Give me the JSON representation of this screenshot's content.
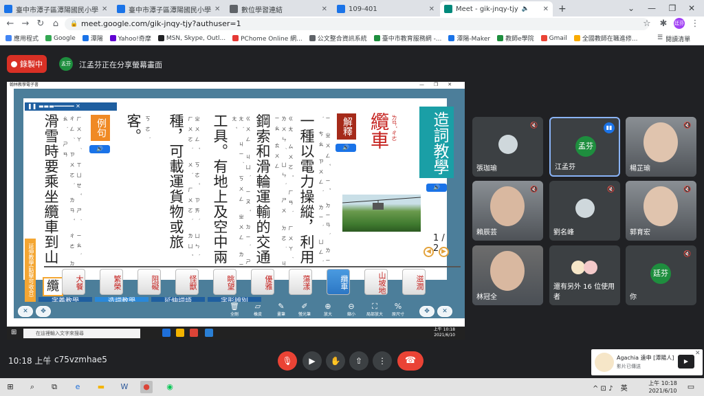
{
  "browser": {
    "tabs": [
      {
        "title": "臺中市潭子區潭陽國民小學",
        "favicon_color": "#1a73e8",
        "active": false
      },
      {
        "title": "臺中市潭子區潭陽國民小學",
        "favicon_color": "#1a73e8",
        "active": false
      },
      {
        "title": "數位學習連結",
        "favicon_color": "#5f6368",
        "active": false
      },
      {
        "title": "109-401",
        "favicon_color": "#1a73e8",
        "active": false
      },
      {
        "title": "Meet - gik-jnqy-tjy",
        "favicon_color": "#00897b",
        "active": true
      }
    ],
    "new_tab": "+",
    "url": "meet.google.com/gik-jnqy-tjy?authuser=1",
    "profile_initials": "廷芬",
    "bookmarks": [
      {
        "label": "應用程式",
        "color": "#4285f4"
      },
      {
        "label": "Google",
        "color": "#34a853"
      },
      {
        "label": "潭陽",
        "color": "#1a73e8"
      },
      {
        "label": "Yahoo!奇摩",
        "color": "#6001d2"
      },
      {
        "label": "MSN, Skype, Outl...",
        "color": "#202124"
      },
      {
        "label": "PChome Online 網...",
        "color": "#e53935"
      },
      {
        "label": "公文整合資訊系統",
        "color": "#5f6368"
      },
      {
        "label": "臺中市教育服務網 -...",
        "color": "#1e8e3e"
      },
      {
        "label": "潭陽-Maker",
        "color": "#1a73e8"
      },
      {
        "label": "教師e學院",
        "color": "#1e8e3e"
      },
      {
        "label": "Gmail",
        "color": "#ea4335"
      },
      {
        "label": "全國教師在職進修...",
        "color": "#f9ab00"
      }
    ],
    "reading_list": "閱讀清單"
  },
  "meet": {
    "record_label": "錄製中",
    "presenter_avatar": "孟芬",
    "presenter_text": "江孟芬正在分享螢幕畫面",
    "clock": "10:18 上午",
    "separator": "|",
    "meeting_code": "c75vzmhae5",
    "participants": [
      {
        "name": "張珈瑜",
        "muted": true,
        "speaking": false,
        "kind": "photo-small"
      },
      {
        "name": "江孟芬",
        "muted": false,
        "speaking": true,
        "avatar": "孟芬",
        "avatar_color": "#1e8e3e",
        "kind": "avatar"
      },
      {
        "name": "楊芷瑜",
        "muted": true,
        "speaking": false,
        "kind": "video"
      },
      {
        "name": "賴辰芸",
        "muted": true,
        "speaking": false,
        "kind": "video"
      },
      {
        "name": "劉名峰",
        "muted": true,
        "speaking": false,
        "kind": "photo-small"
      },
      {
        "name": "郭育宏",
        "muted": true,
        "speaking": false,
        "kind": "video"
      },
      {
        "name": "林冠全",
        "muted": false,
        "speaking": false,
        "kind": "video"
      },
      {
        "name": "還有另外 16 位使用者",
        "muted": false,
        "speaking": false,
        "kind": "group"
      },
      {
        "name": "你",
        "muted": true,
        "speaking": false,
        "avatar": "廷芬",
        "avatar_color": "#1e8e3e",
        "kind": "avatar"
      }
    ]
  },
  "ebook": {
    "window_title": "翰林教學電子書",
    "headword": "纜車",
    "headword_zhuyin": "ㄌㄢˇ ㄔㄜ",
    "category": "造詞教學",
    "explain_badge": "解釋",
    "example_badge": "例句",
    "speaker_icon": "🔊",
    "definition_columns": [
      "一種以電力操縱，利用",
      "鋼索和滑輪運輸的交通",
      "工具。有地上及空中兩",
      "種，可載運貨物或旅",
      "客。"
    ],
    "definition_zhuyin": [
      "ㄧ ㄓㄨㄥˇ ㄧˇ ㄉㄧㄢˋ ㄌㄧˋ ㄘㄠ ㄗㄨㄥˋ ㄌㄧˋ ㄩㄥˋ",
      "ㄍㄤ ㄙㄨㄛˇ ㄏㄢˋ ㄏㄨㄚˊ ㄌㄨㄣˊ ㄩㄣˋ ㄕㄨ ㄉㄜ˙ ㄐㄧㄠ ㄊㄨㄥ",
      "ㄍㄨㄥ ㄐㄩˋ ㄧㄡˇ ㄉㄧˋ ㄕㄤˋ ㄐㄧˊ ㄎㄨㄥ ㄓㄨㄥ ㄌㄧㄤˇ",
      "ㄓㄨㄥˇ ㄎㄜˇ ㄗㄞˋ ㄩㄣˋ ㄏㄨㄛˋ ㄨˋ ㄏㄨㄛˋ ㄌㄩˇ",
      "ㄎㄜˋ"
    ],
    "example_column": "滑雪時要乘坐纜車到山",
    "example_zhuyin": "ㄏㄨㄚˊ ㄒㄩㄝˇ ㄕˊ ㄧㄠˋ ㄔㄥˊ ㄗㄨㄛˋ ㄌㄢˇ ㄔㄜ ㄉㄠˋ ㄕㄢ",
    "page_indicator": "1 / 2",
    "prev_icon": "◀",
    "next_icon": "▶",
    "sidebar_label": "延伸教學(點擊可收合)",
    "current_char": "纜",
    "word_cards": [
      {
        "word": "大餐",
        "selected": false
      },
      {
        "word": "繁榮",
        "selected": false
      },
      {
        "word": "阻礙",
        "selected": false
      },
      {
        "word": "怪獸",
        "selected": false
      },
      {
        "word": "眺望",
        "selected": false
      },
      {
        "word": "優雅",
        "selected": false
      },
      {
        "word": "蕩漾",
        "selected": false
      },
      {
        "word": "纜車",
        "selected": true
      },
      {
        "word": "山坡地",
        "selected": false
      },
      {
        "word": "滋潤",
        "selected": false
      }
    ],
    "content_tabs": [
      {
        "label": "字義教學",
        "active": false
      },
      {
        "label": "造詞教學",
        "active": true
      },
      {
        "label": "延伸詞語",
        "active": false
      },
      {
        "label": "字形辨別",
        "active": false
      }
    ],
    "tools": [
      {
        "label": "全刪",
        "icon": "🗑"
      },
      {
        "label": "橡皮",
        "icon": "▱"
      },
      {
        "label": "畫筆",
        "icon": "✎"
      },
      {
        "label": "螢光筆",
        "icon": "✐"
      },
      {
        "label": "放大",
        "icon": "⊕"
      },
      {
        "label": "縮小",
        "icon": "⊖"
      },
      {
        "label": "局部放大",
        "icon": "⛶"
      },
      {
        "label": "原尺寸",
        "icon": "%"
      }
    ],
    "taskbar_search": "在這裡輸入文字來搜尋",
    "taskbar_time": "上午 10:18",
    "taskbar_date": "2021/6/10"
  },
  "toast": {
    "title": "Agachia 遠申 [潭陽人]",
    "subtitle": "影片已傳送"
  },
  "taskbar": {
    "time": "上午 10:18",
    "date": "2021/6/10",
    "ime": "英",
    "tray": "^ ⊡ ♪"
  }
}
